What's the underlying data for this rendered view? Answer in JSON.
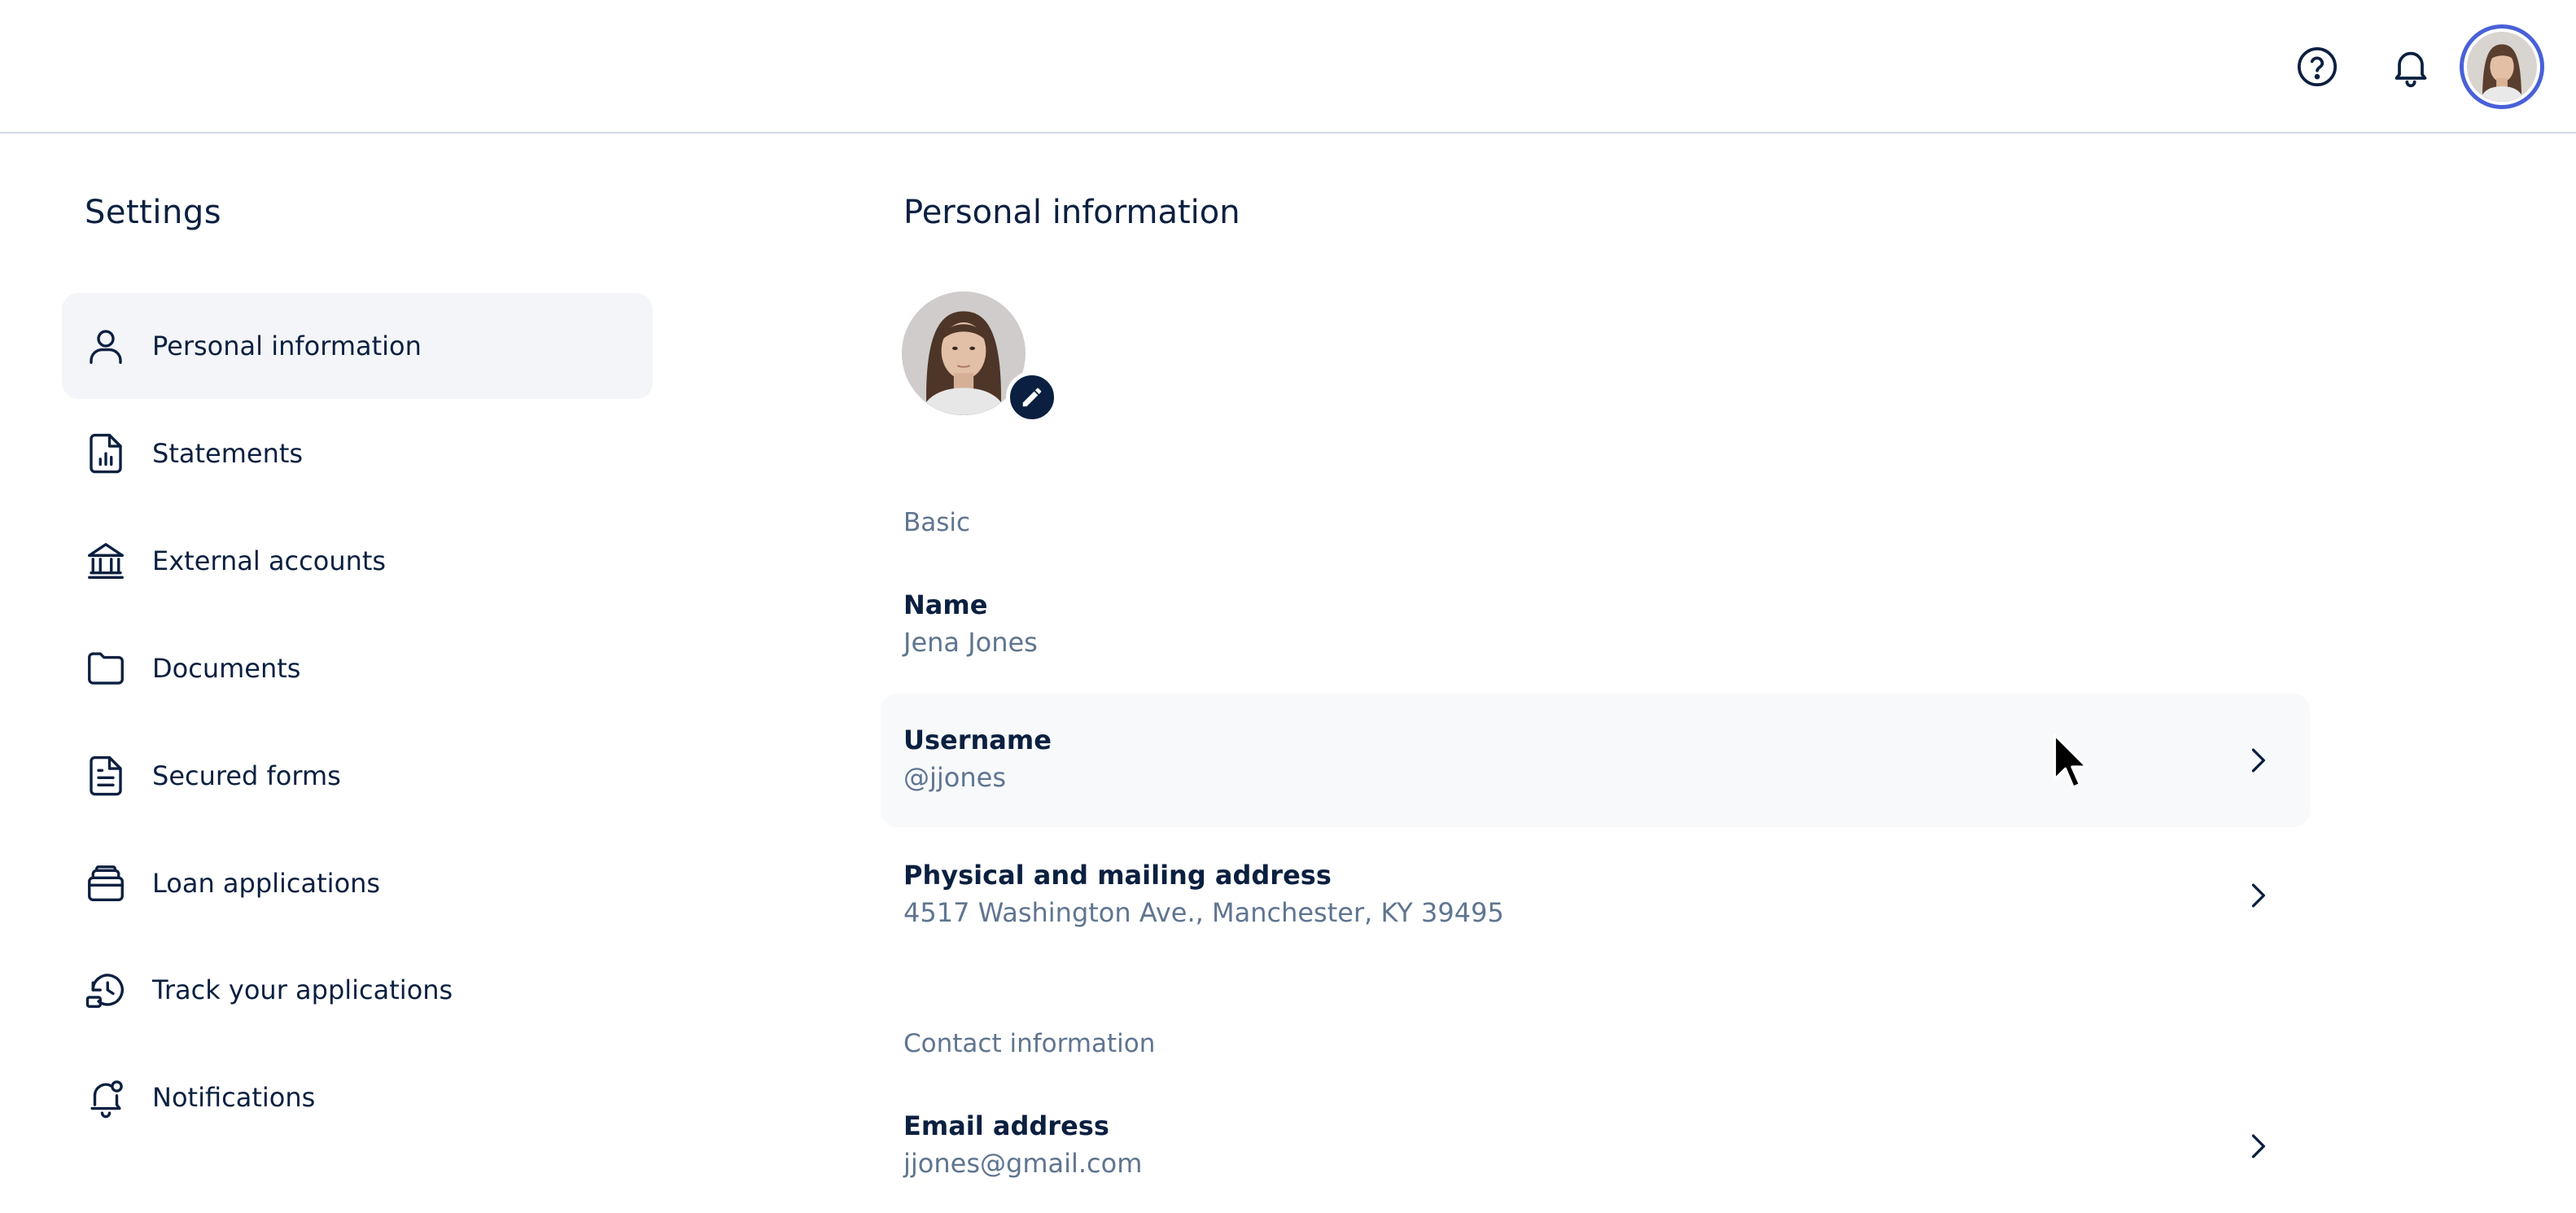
{
  "header": {
    "help_icon": "help-circle-icon",
    "notifications_icon": "bell-icon",
    "avatar_icon": "user-avatar"
  },
  "colors": {
    "primary_text": "#0b2040",
    "muted_text": "#5f7590",
    "active_bg": "#f3f5f8",
    "avatar_ring": "#4961d8"
  },
  "sidebar": {
    "title": "Settings",
    "items": [
      {
        "label": "Personal information",
        "icon": "person-icon",
        "active": true
      },
      {
        "label": "Statements",
        "icon": "chart-document-icon",
        "active": false
      },
      {
        "label": "External accounts",
        "icon": "bank-icon",
        "active": false
      },
      {
        "label": "Documents",
        "icon": "folder-icon",
        "active": false
      },
      {
        "label": "Secured forms",
        "icon": "form-document-icon",
        "active": false
      },
      {
        "label": "Loan applications",
        "icon": "stack-icon",
        "active": false
      },
      {
        "label": "Track your applications",
        "icon": "history-icon",
        "active": false
      },
      {
        "label": "Notifications",
        "icon": "bell-settings-icon",
        "active": false
      }
    ]
  },
  "main": {
    "title": "Personal information",
    "photo_edit_icon": "pencil-icon",
    "sections": {
      "basic": {
        "heading": "Basic",
        "fields": {
          "name": {
            "label": "Name",
            "value": "Jena Jones"
          },
          "username": {
            "label": "Username",
            "value": "@jjones"
          },
          "address": {
            "label": "Physical and mailing address",
            "value": "4517 Washington Ave., Manchester, KY 39495"
          }
        }
      },
      "contact": {
        "heading": "Contact information",
        "fields": {
          "email": {
            "label": "Email address",
            "value": "jjones@gmail.com"
          }
        }
      }
    }
  }
}
